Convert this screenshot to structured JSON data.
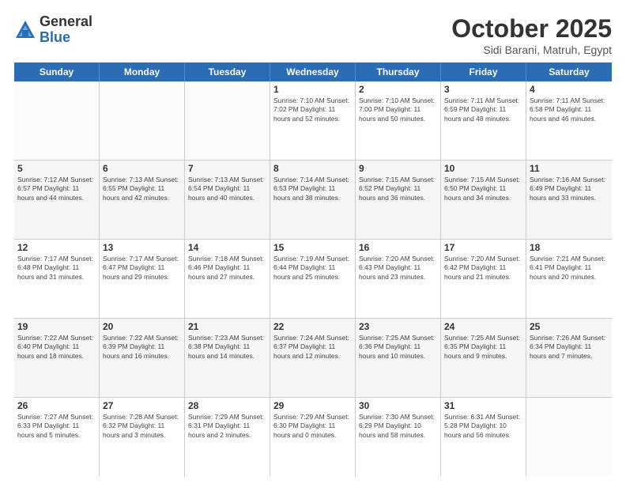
{
  "logo": {
    "general": "General",
    "blue": "Blue"
  },
  "title": "October 2025",
  "location": "Sidi Barani, Matruh, Egypt",
  "weekdays": [
    "Sunday",
    "Monday",
    "Tuesday",
    "Wednesday",
    "Thursday",
    "Friday",
    "Saturday"
  ],
  "weeks": [
    [
      {
        "day": "",
        "info": ""
      },
      {
        "day": "",
        "info": ""
      },
      {
        "day": "",
        "info": ""
      },
      {
        "day": "1",
        "info": "Sunrise: 7:10 AM\nSunset: 7:02 PM\nDaylight: 11 hours\nand 52 minutes."
      },
      {
        "day": "2",
        "info": "Sunrise: 7:10 AM\nSunset: 7:00 PM\nDaylight: 11 hours\nand 50 minutes."
      },
      {
        "day": "3",
        "info": "Sunrise: 7:11 AM\nSunset: 6:59 PM\nDaylight: 11 hours\nand 48 minutes."
      },
      {
        "day": "4",
        "info": "Sunrise: 7:11 AM\nSunset: 6:58 PM\nDaylight: 11 hours\nand 46 minutes."
      }
    ],
    [
      {
        "day": "5",
        "info": "Sunrise: 7:12 AM\nSunset: 6:57 PM\nDaylight: 11 hours\nand 44 minutes."
      },
      {
        "day": "6",
        "info": "Sunrise: 7:13 AM\nSunset: 6:55 PM\nDaylight: 11 hours\nand 42 minutes."
      },
      {
        "day": "7",
        "info": "Sunrise: 7:13 AM\nSunset: 6:54 PM\nDaylight: 11 hours\nand 40 minutes."
      },
      {
        "day": "8",
        "info": "Sunrise: 7:14 AM\nSunset: 6:53 PM\nDaylight: 11 hours\nand 38 minutes."
      },
      {
        "day": "9",
        "info": "Sunrise: 7:15 AM\nSunset: 6:52 PM\nDaylight: 11 hours\nand 36 minutes."
      },
      {
        "day": "10",
        "info": "Sunrise: 7:15 AM\nSunset: 6:50 PM\nDaylight: 11 hours\nand 34 minutes."
      },
      {
        "day": "11",
        "info": "Sunrise: 7:16 AM\nSunset: 6:49 PM\nDaylight: 11 hours\nand 33 minutes."
      }
    ],
    [
      {
        "day": "12",
        "info": "Sunrise: 7:17 AM\nSunset: 6:48 PM\nDaylight: 11 hours\nand 31 minutes."
      },
      {
        "day": "13",
        "info": "Sunrise: 7:17 AM\nSunset: 6:47 PM\nDaylight: 11 hours\nand 29 minutes."
      },
      {
        "day": "14",
        "info": "Sunrise: 7:18 AM\nSunset: 6:46 PM\nDaylight: 11 hours\nand 27 minutes."
      },
      {
        "day": "15",
        "info": "Sunrise: 7:19 AM\nSunset: 6:44 PM\nDaylight: 11 hours\nand 25 minutes."
      },
      {
        "day": "16",
        "info": "Sunrise: 7:20 AM\nSunset: 6:43 PM\nDaylight: 11 hours\nand 23 minutes."
      },
      {
        "day": "17",
        "info": "Sunrise: 7:20 AM\nSunset: 6:42 PM\nDaylight: 11 hours\nand 21 minutes."
      },
      {
        "day": "18",
        "info": "Sunrise: 7:21 AM\nSunset: 6:41 PM\nDaylight: 11 hours\nand 20 minutes."
      }
    ],
    [
      {
        "day": "19",
        "info": "Sunrise: 7:22 AM\nSunset: 6:40 PM\nDaylight: 11 hours\nand 18 minutes."
      },
      {
        "day": "20",
        "info": "Sunrise: 7:22 AM\nSunset: 6:39 PM\nDaylight: 11 hours\nand 16 minutes."
      },
      {
        "day": "21",
        "info": "Sunrise: 7:23 AM\nSunset: 6:38 PM\nDaylight: 11 hours\nand 14 minutes."
      },
      {
        "day": "22",
        "info": "Sunrise: 7:24 AM\nSunset: 6:37 PM\nDaylight: 11 hours\nand 12 minutes."
      },
      {
        "day": "23",
        "info": "Sunrise: 7:25 AM\nSunset: 6:36 PM\nDaylight: 11 hours\nand 10 minutes."
      },
      {
        "day": "24",
        "info": "Sunrise: 7:25 AM\nSunset: 6:35 PM\nDaylight: 11 hours\nand 9 minutes."
      },
      {
        "day": "25",
        "info": "Sunrise: 7:26 AM\nSunset: 6:34 PM\nDaylight: 11 hours\nand 7 minutes."
      }
    ],
    [
      {
        "day": "26",
        "info": "Sunrise: 7:27 AM\nSunset: 6:33 PM\nDaylight: 11 hours\nand 5 minutes."
      },
      {
        "day": "27",
        "info": "Sunrise: 7:28 AM\nSunset: 6:32 PM\nDaylight: 11 hours\nand 3 minutes."
      },
      {
        "day": "28",
        "info": "Sunrise: 7:29 AM\nSunset: 6:31 PM\nDaylight: 11 hours\nand 2 minutes."
      },
      {
        "day": "29",
        "info": "Sunrise: 7:29 AM\nSunset: 6:30 PM\nDaylight: 11 hours\nand 0 minutes."
      },
      {
        "day": "30",
        "info": "Sunrise: 7:30 AM\nSunset: 6:29 PM\nDaylight: 10 hours\nand 58 minutes."
      },
      {
        "day": "31",
        "info": "Sunrise: 6:31 AM\nSunset: 5:28 PM\nDaylight: 10 hours\nand 56 minutes."
      },
      {
        "day": "",
        "info": ""
      }
    ]
  ]
}
